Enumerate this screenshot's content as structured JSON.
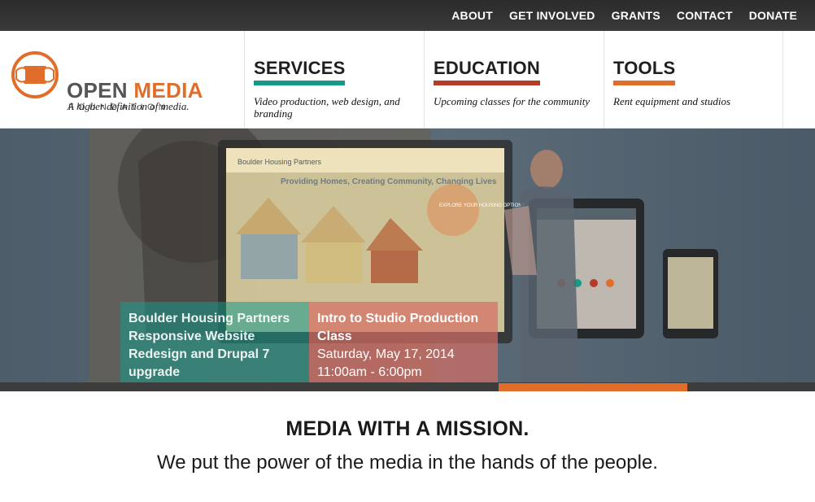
{
  "topnav": {
    "items": [
      "ABOUT",
      "GET INVOLVED",
      "GRANTS",
      "CONTACT",
      "DONATE"
    ]
  },
  "brand": {
    "word1": "OPEN",
    "word2": "MEDIA",
    "word3": "FOUNDATION",
    "tagline": "A higher definition of media.",
    "colors": {
      "orange": "#e06e2a",
      "gray": "#555555"
    }
  },
  "sections": [
    {
      "title": "SERVICES",
      "desc": "Video production, web design, and branding",
      "color": "#17998a"
    },
    {
      "title": "EDUCATION",
      "desc": "Upcoming classes for the community",
      "color": "#b53a28"
    },
    {
      "title": "TOOLS",
      "desc": "Rent equipment and studios",
      "color": "#e06e2a"
    }
  ],
  "hero": {
    "slides": [
      {
        "title": "Boulder Housing Partners Responsive Website Redesign and Drupal 7 upgrade",
        "color": "#17998a"
      },
      {
        "title": "Intro to Studio Production Class",
        "date": "Saturday, May 17, 2014",
        "time": "11:00am - 6:00pm",
        "color": "#b53a28"
      },
      {
        "title": "",
        "color": "#e06e2a"
      }
    ],
    "screen": {
      "brand": "Boulder Housing Partners",
      "headline": "Providing Homes, Creating Community, Changing Lives",
      "callout": "EXPLORE YOUR HOUSING OPTIONS"
    }
  },
  "mission": {
    "title": "MEDIA WITH A MISSION.",
    "subtitle": "We put the power of the media in the hands of the people."
  }
}
